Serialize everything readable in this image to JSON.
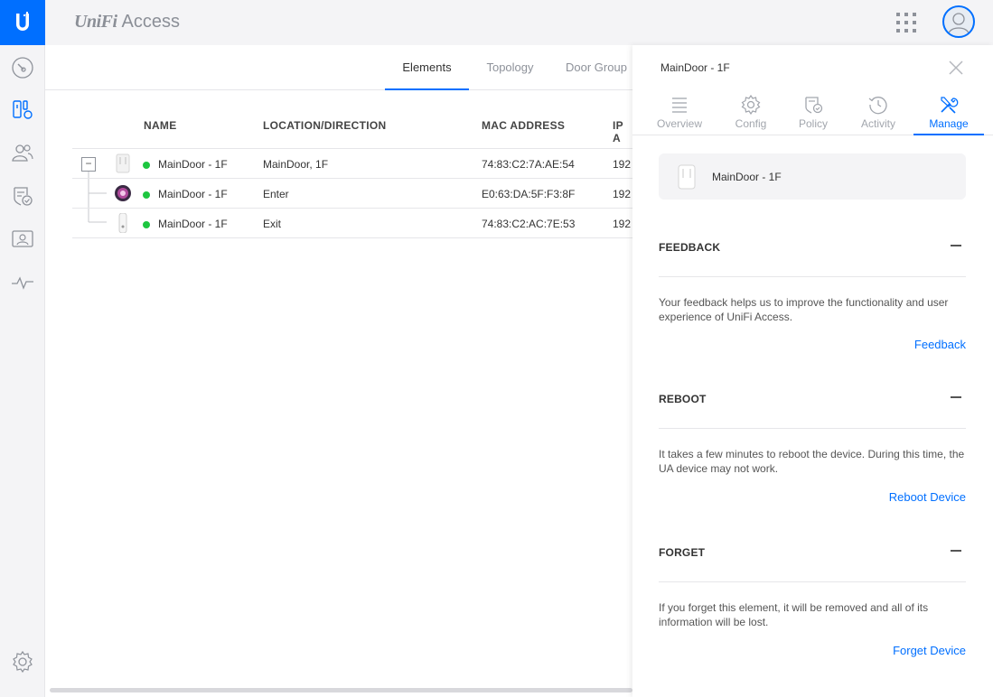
{
  "app": {
    "brand_uni": "UniFi",
    "brand_name": "Access"
  },
  "colors": {
    "accent": "#006fff",
    "online": "#1ec640"
  },
  "sidebar": {
    "items": [
      {
        "name": "dashboard-icon"
      },
      {
        "name": "devices-icon"
      },
      {
        "name": "users-icon"
      },
      {
        "name": "policies-icon"
      },
      {
        "name": "visitors-icon"
      },
      {
        "name": "activity-icon"
      },
      {
        "name": "settings-icon"
      }
    ]
  },
  "main": {
    "tabs": [
      "Elements",
      "Topology",
      "Door Group"
    ],
    "active_tab": 0
  },
  "table": {
    "columns": [
      "NAME",
      "LOCATION/DIRECTION",
      "MAC ADDRESS",
      "IP A"
    ],
    "rows": [
      {
        "name": "MainDoor - 1F",
        "location": "MainDoor, 1F",
        "mac": "74:83:C2:7A:AE:54",
        "ip": "192",
        "status": "online",
        "icon": "hub-device-icon"
      },
      {
        "name": "MainDoor - 1F",
        "location": "Enter",
        "mac": "E0:63:DA:5F:F3:8F",
        "ip": "192",
        "status": "online",
        "icon": "pro-reader-icon"
      },
      {
        "name": "MainDoor - 1F",
        "location": "Exit",
        "mac": "74:83:C2:AC:7E:53",
        "ip": "192",
        "status": "online",
        "icon": "reader-lite-icon"
      }
    ],
    "collapse_symbol": "−"
  },
  "panel": {
    "title": "MainDoor - 1F",
    "tabs": [
      {
        "label": "Overview",
        "icon": "list-icon"
      },
      {
        "label": "Config",
        "icon": "gear-icon"
      },
      {
        "label": "Policy",
        "icon": "policy-shield-icon"
      },
      {
        "label": "Activity",
        "icon": "history-icon"
      },
      {
        "label": "Manage",
        "icon": "tools-icon"
      }
    ],
    "active_tab": 4,
    "device_name": "MainDoor - 1F",
    "sections": [
      {
        "title": "FEEDBACK",
        "text": "Your feedback helps us to improve the functionality and user experience of UniFi Access.",
        "link": "Feedback"
      },
      {
        "title": "REBOOT",
        "text": "It takes a few minutes to reboot the device. During this time, the UA device may not work.",
        "link": "Reboot Device"
      },
      {
        "title": "FORGET",
        "text": "If you forget this element, it will be removed and all of its information will be lost.",
        "link": "Forget Device"
      }
    ]
  }
}
